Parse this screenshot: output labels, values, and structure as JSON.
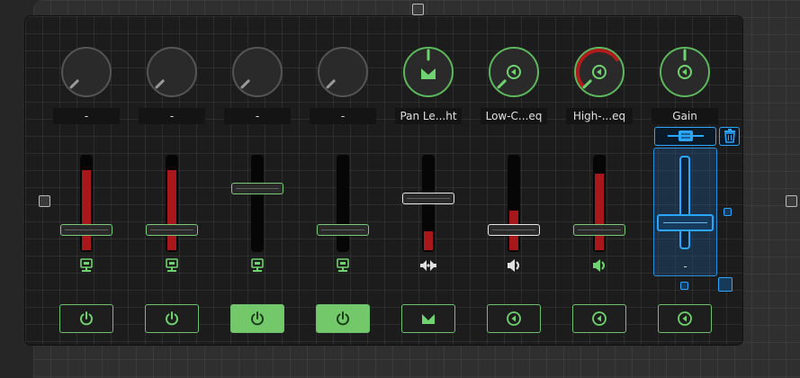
{
  "strips": [
    {
      "label": "-",
      "active": false,
      "knob_arc": 0,
      "fader_level": 0.18,
      "fader_red": 0.86,
      "cap": "green",
      "icon": "monitor-icon",
      "button_active": false,
      "button_icon": "power-icon"
    },
    {
      "label": "-",
      "active": false,
      "knob_arc": 0,
      "fader_level": 0.18,
      "fader_red": 0.86,
      "cap": "green",
      "icon": "monitor-icon",
      "button_active": false,
      "button_icon": "power-icon"
    },
    {
      "label": "-",
      "active": false,
      "knob_arc": 0,
      "fader_level": 0.6,
      "fader_red": 0,
      "cap": "green",
      "icon": "monitor-icon",
      "button_active": true,
      "button_icon": "power-icon"
    },
    {
      "label": "-",
      "active": false,
      "knob_arc": 0,
      "fader_level": 0.18,
      "fader_red": 0,
      "cap": "green",
      "icon": "monitor-icon",
      "button_active": true,
      "button_icon": "power-icon"
    },
    {
      "label": "Pan Le...ht",
      "active": true,
      "knob_arc": 0,
      "fader_level": 0.5,
      "fader_red": 0.2,
      "cap": "white",
      "icon": "pan-speaker-icon",
      "button_active": false,
      "button_icon": "pan-icon"
    },
    {
      "label": "Low-C...eq",
      "active": true,
      "knob_arc": 0,
      "fader_level": 0.18,
      "fader_red": 0.42,
      "cap": "white",
      "icon": "speaker-icon",
      "button_active": false,
      "button_icon": "filter-icon"
    },
    {
      "label": "High-...eq",
      "active": true,
      "knob_arc": 0.72,
      "fader_level": 0.18,
      "fader_red": 0.82,
      "cap": "green",
      "icon": "speaker-green-icon",
      "button_active": false,
      "button_icon": "filter-icon"
    },
    {
      "label": "Gain",
      "active": true,
      "knob_arc": 0,
      "fader_level": 0,
      "fader_red": 0,
      "cap": "none",
      "icon": "none",
      "button_active": false,
      "button_icon": "filter-icon"
    }
  ],
  "selected_strip": {
    "label": "-",
    "fader_level": 0.5
  }
}
